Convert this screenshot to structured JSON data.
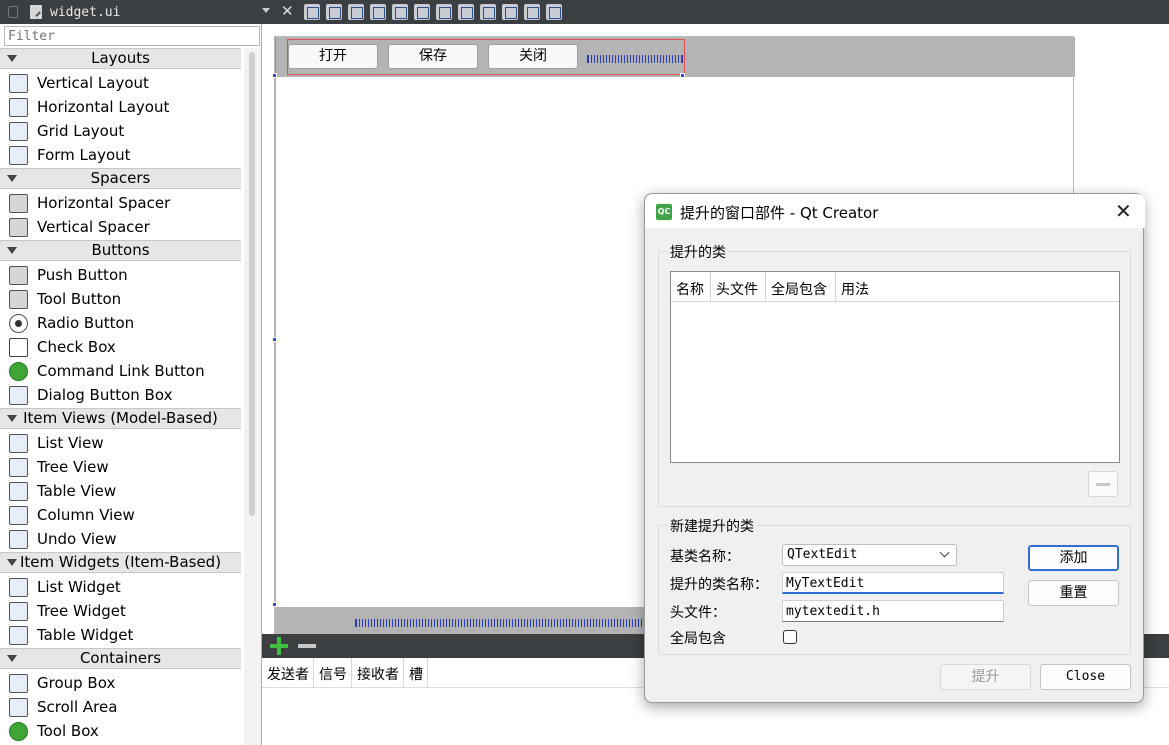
{
  "toolbar": {
    "file_name": "widget.ui",
    "close_label": "✕"
  },
  "widgetbox": {
    "filter_placeholder": "Filter",
    "categories": [
      {
        "title": "Layouts",
        "items": [
          "Vertical Layout",
          "Horizontal Layout",
          "Grid Layout",
          "Form Layout"
        ]
      },
      {
        "title": "Spacers",
        "items": [
          "Horizontal Spacer",
          "Vertical Spacer"
        ]
      },
      {
        "title": "Buttons",
        "items": [
          "Push Button",
          "Tool Button",
          "Radio Button",
          "Check Box",
          "Command Link Button",
          "Dialog Button Box"
        ]
      },
      {
        "title": "Item Views (Model-Based)",
        "items": [
          "List View",
          "Tree View",
          "Table View",
          "Column View",
          "Undo View"
        ]
      },
      {
        "title": "Item Widgets (Item-Based)",
        "items": [
          "List Widget",
          "Tree Widget",
          "Table Widget"
        ]
      },
      {
        "title": "Containers",
        "items": [
          "Group Box",
          "Scroll Area",
          "Tool Box"
        ]
      }
    ]
  },
  "form": {
    "buttons": [
      "打开",
      "保存",
      "关闭"
    ]
  },
  "signals": {
    "columns": [
      "发送者",
      "信号",
      "接收者",
      "槽"
    ]
  },
  "dialog": {
    "title": "提升的窗口部件 - Qt Creator",
    "icon_text": "QC",
    "promoted_group_title": "提升的类",
    "table_columns": [
      "名称",
      "头文件",
      "全局包含",
      "用法"
    ],
    "new_group_title": "新建提升的类",
    "base_class_label": "基类名称：",
    "base_class_value": "QTextEdit",
    "promoted_name_label": "提升的类名称：",
    "promoted_name_value": "MyTextEdit",
    "header_label": "头文件：",
    "header_value": "mytextedit.h",
    "global_include_label": "全局包含",
    "add_label": "添加",
    "reset_label": "重置",
    "promote_label": "提升",
    "close_label": "Close"
  }
}
